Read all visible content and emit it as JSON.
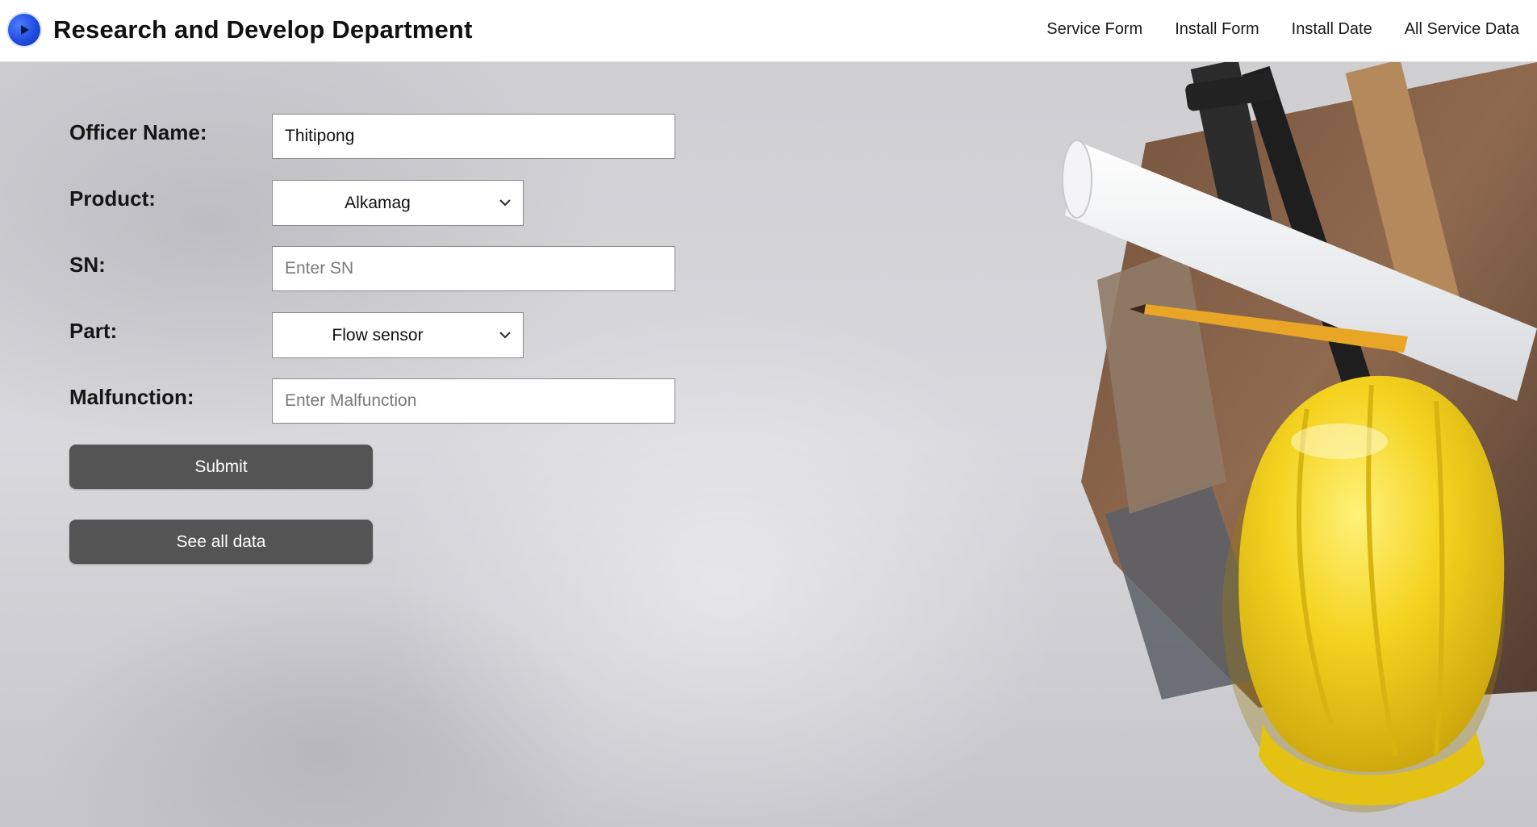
{
  "header": {
    "title": "Research and Develop Department",
    "logo_icon": "play-circle-icon",
    "nav": [
      {
        "label": "Service Form"
      },
      {
        "label": "Install Form"
      },
      {
        "label": "Install Date"
      },
      {
        "label": "All Service Data"
      }
    ]
  },
  "form": {
    "officer_name": {
      "label": "Officer Name:",
      "value": "Thitipong"
    },
    "product": {
      "label": "Product:",
      "selected": "Alkamag"
    },
    "sn": {
      "label": "SN:",
      "placeholder": "Enter SN",
      "value": ""
    },
    "part": {
      "label": "Part:",
      "selected": "Flow sensor"
    },
    "malfunction": {
      "label": "Malfunction:",
      "placeholder": "Enter Malfunction",
      "value": ""
    },
    "submit_label": "Submit",
    "see_all_label": "See all data"
  },
  "colors": {
    "button_bg": "#545454",
    "brand_blue": "#1f4de0",
    "helmet_yellow": "#f2d21a"
  }
}
